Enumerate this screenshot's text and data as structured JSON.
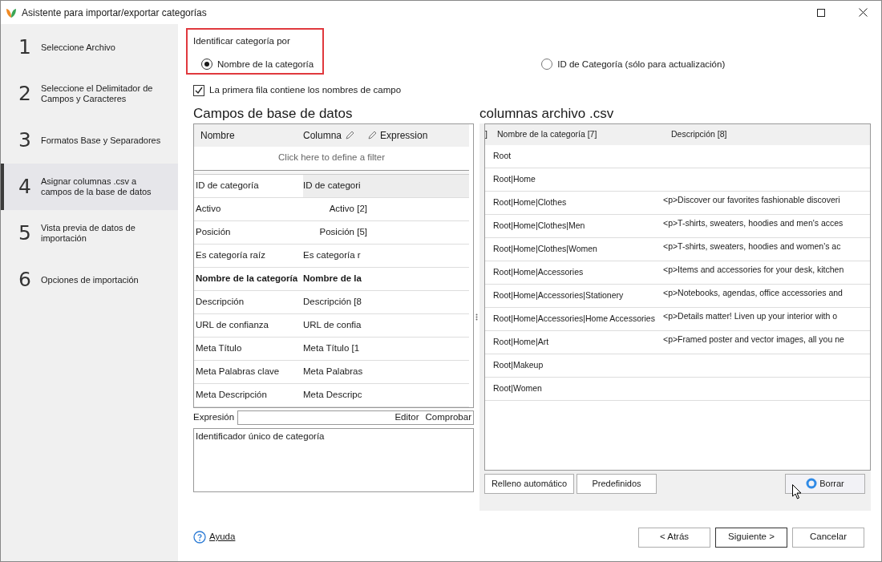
{
  "window": {
    "title": "Asistente para importar/exportar categorías"
  },
  "steps": [
    {
      "number": "1",
      "label": "Seleccione Archivo",
      "selected": false
    },
    {
      "number": "2",
      "label": "Seleccione el Delimitador de Campos y Caracteres",
      "selected": false
    },
    {
      "number": "3",
      "label": "Formatos Base y Separadores",
      "selected": false
    },
    {
      "number": "4",
      "label": "Asignar columnas .csv a campos de la base de datos",
      "selected": true
    },
    {
      "number": "5",
      "label": "Vista previa de datos de importación",
      "selected": false
    },
    {
      "number": "6",
      "label": "Opciones de importación",
      "selected": false
    }
  ],
  "identify": {
    "label": "Identificar categoría por",
    "options": [
      {
        "label": "Nombre de la categoría",
        "selected": true
      },
      {
        "label": "ID de Categoría (sólo para actualización)",
        "selected": false
      }
    ]
  },
  "first_row_option": {
    "label": "La primera fila contiene los nombres de campo",
    "checked": true
  },
  "db_fields": {
    "title": "Campos de base de datos",
    "columns": [
      "Nombre",
      "Columna",
      "Expression"
    ],
    "filter_hint": "Click here to define a filter",
    "rows": [
      {
        "name": "ID de categoría",
        "column": "ID de categori",
        "kind": "text",
        "bold": false,
        "selected": true
      },
      {
        "name": "Activo",
        "column": "Activo [2]",
        "kind": "numeric",
        "bold": false,
        "selected": false
      },
      {
        "name": "Posición",
        "column": "Posición [5]",
        "kind": "numeric",
        "bold": false,
        "selected": false
      },
      {
        "name": "Es categoría raíz",
        "column": "Es categoría r",
        "kind": "text",
        "bold": false,
        "selected": false
      },
      {
        "name": "Nombre de la categoría",
        "column": "Nombre de la",
        "kind": "text",
        "bold": true,
        "selected": false
      },
      {
        "name": "Descripción",
        "column": "Descripción [8",
        "kind": "text",
        "bold": false,
        "selected": false
      },
      {
        "name": "URL de confianza",
        "column": "URL de confia",
        "kind": "text",
        "bold": false,
        "selected": false
      },
      {
        "name": "Meta Título",
        "column": "Meta Título [1",
        "kind": "text",
        "bold": false,
        "selected": false
      },
      {
        "name": "Meta Palabras clave",
        "column": "Meta Palabras",
        "kind": "text",
        "bold": false,
        "selected": false
      },
      {
        "name": "Meta Descripción",
        "column": "Meta Descripc",
        "kind": "text",
        "bold": false,
        "selected": false
      }
    ]
  },
  "expression": {
    "label": "Expresión",
    "buttons": [
      "Editor",
      "Comprobar"
    ],
    "description": "Identificador único de categoría"
  },
  "csv": {
    "title": "columnas archivo .csv",
    "columns": [
      "]",
      "Nombre de la categoría [7]",
      "Descripción [8]"
    ],
    "rows": [
      {
        "name": "Root"
      },
      {
        "name": "Root|Home"
      },
      {
        "name": "Root|Home|Clothes",
        "description": "<p>Discover our favorites fashionable discoveri"
      },
      {
        "name": "Root|Home|Clothes|Men",
        "description": "<p>T-shirts, sweaters, hoodies and men's acces"
      },
      {
        "name": "Root|Home|Clothes|Women",
        "description": "<p>T-shirts, sweaters, hoodies and women's ac"
      },
      {
        "name": "Root|Home|Accessories",
        "description": "<p>Items and accessories for your desk, kitchen"
      },
      {
        "name": "Root|Home|Accessories|Stationery",
        "description": "<p>Notebooks, agendas, office accessories and"
      },
      {
        "name": "Root|Home|Accessories|Home Accessories",
        "description": "<p>Details matter! Liven up your interior with o"
      },
      {
        "name": "Root|Home|Art",
        "description": "<p>Framed poster and vector images, all you ne"
      },
      {
        "name": "Root|Makeup"
      },
      {
        "name": "Root|Women"
      }
    ],
    "buttons": [
      "Relleno automático",
      "Predefinidos",
      "Borrar"
    ]
  },
  "footer": {
    "help": "Ayuda",
    "buttons": [
      "< Atrás",
      "Siguiente >",
      "Cancelar"
    ]
  }
}
